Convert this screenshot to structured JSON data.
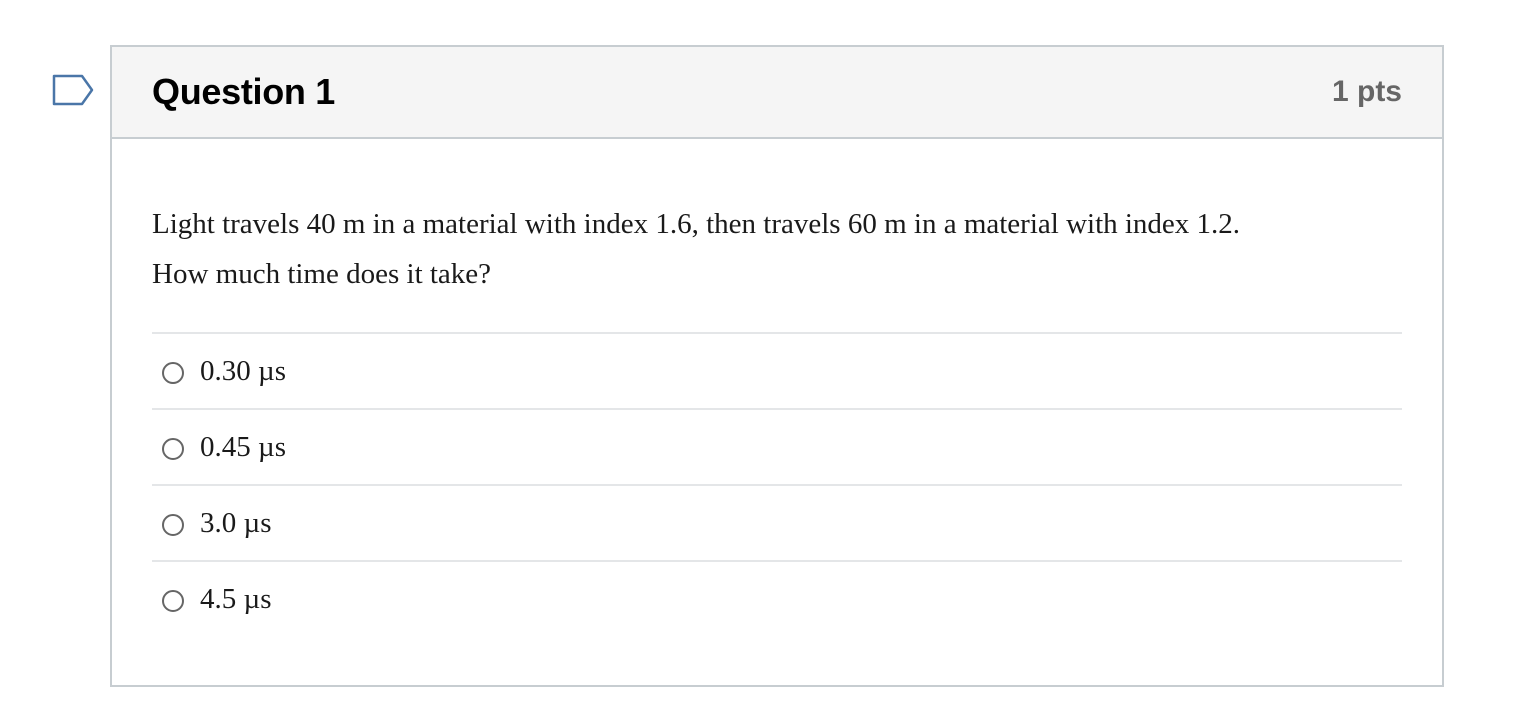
{
  "question": {
    "title": "Question 1",
    "points": "1 pts",
    "text_line1": "Light travels 40 m in a material with index 1.6, then travels 60 m in a material with index 1.2.",
    "text_line2": "How much time does it take?",
    "answers": [
      {
        "label": "0.30 µs",
        "selected": false
      },
      {
        "label": "0.45 µs",
        "selected": false
      },
      {
        "label": "3.0 µs",
        "selected": false
      },
      {
        "label": "4.5 µs",
        "selected": false
      }
    ]
  },
  "icons": {
    "flag": "bookmark-flag-icon"
  },
  "colors": {
    "flag_stroke": "#4a76a8",
    "border": "#c7cdd1",
    "header_bg": "#f5f5f5",
    "points_text": "#666666"
  }
}
